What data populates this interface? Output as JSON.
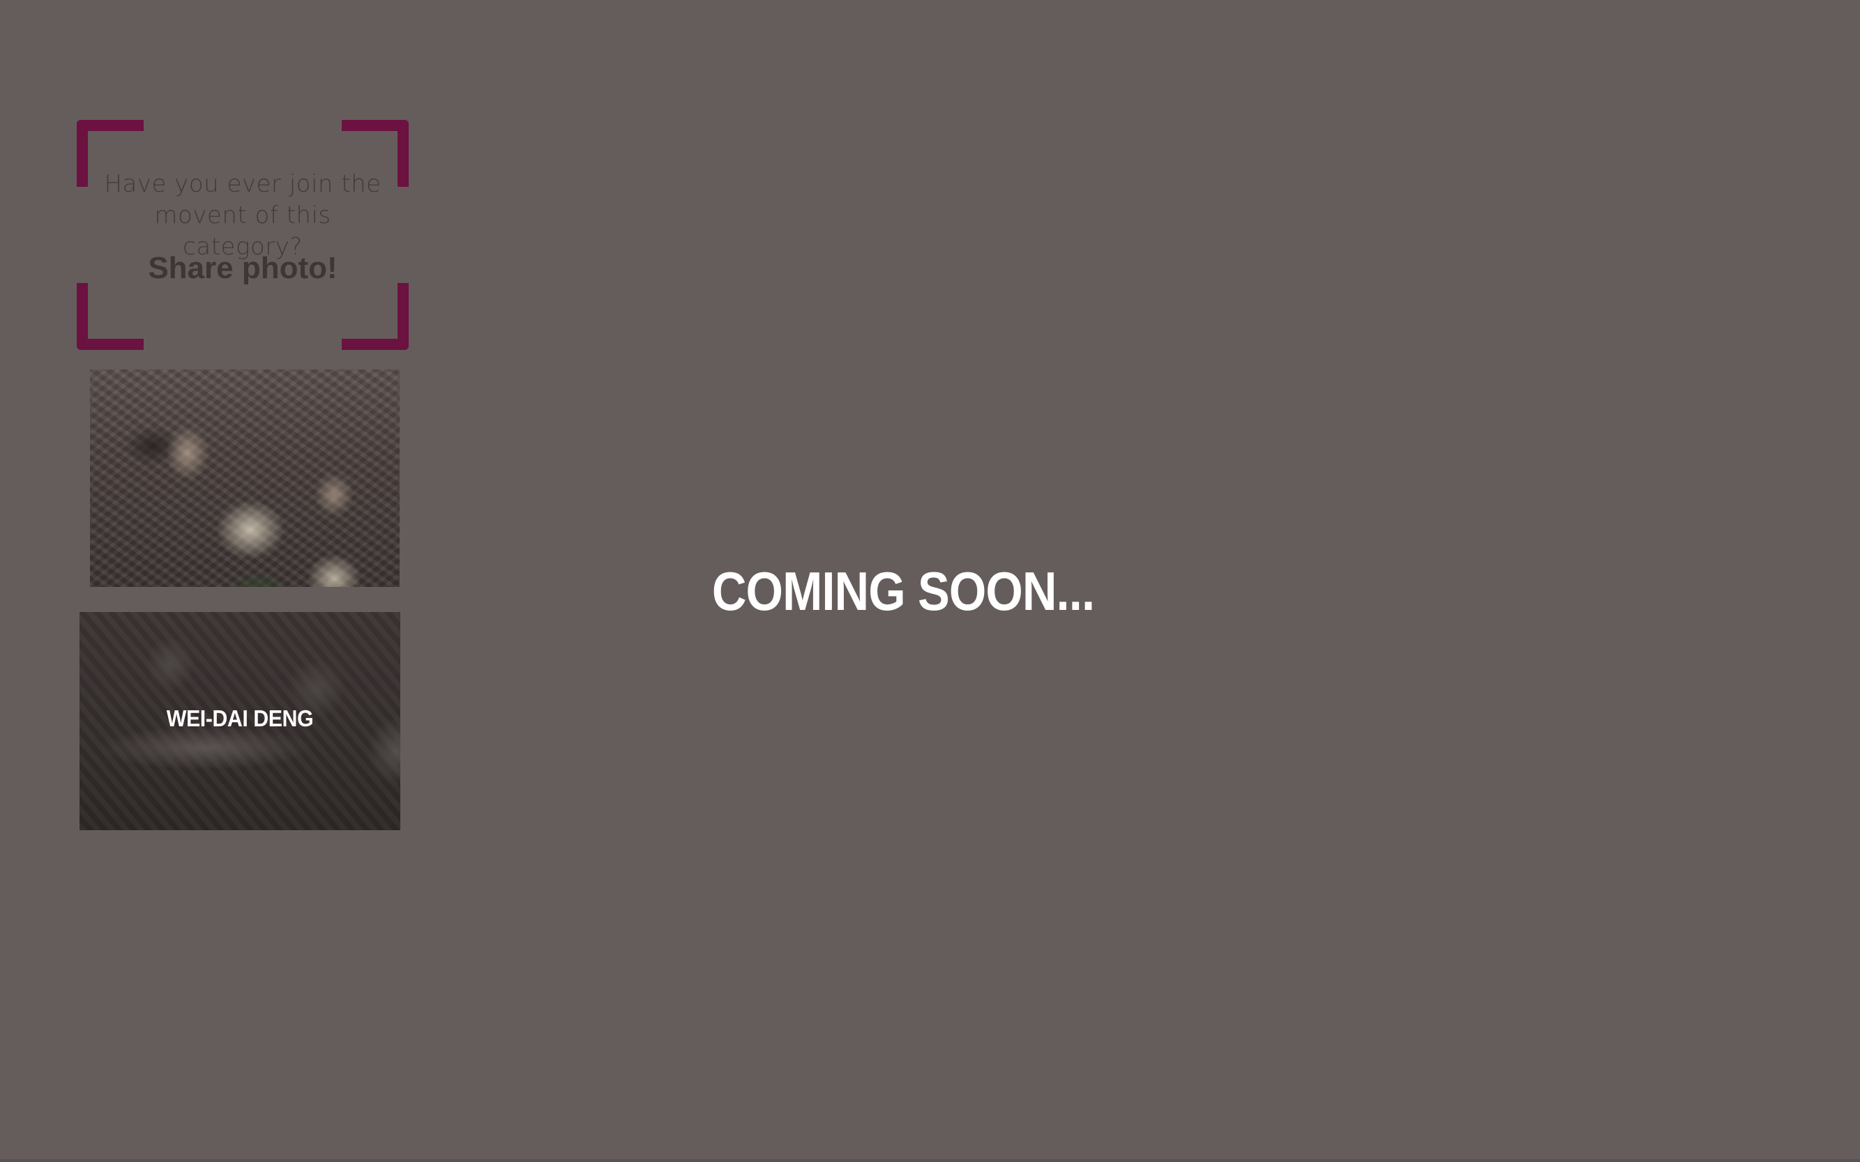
{
  "share_prompt": {
    "question": "Have you ever join the movent of this category?",
    "cta": "Share photo!"
  },
  "photos": [
    {
      "label": ""
    },
    {
      "label": "WEI-DAI DENG"
    }
  ],
  "main": {
    "message": "COMING SOON..."
  },
  "colors": {
    "background": "#655d5c",
    "bracket_accent": "#6b1240",
    "text_primary": "#ffffff",
    "text_muted": "#413a39"
  }
}
